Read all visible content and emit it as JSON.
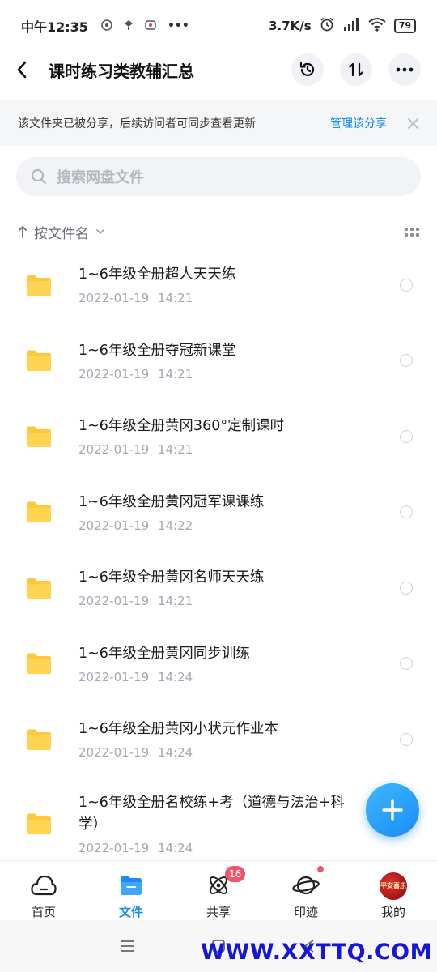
{
  "status_bar": {
    "time": "中午12:35",
    "more": "•••",
    "network_speed": "3.7K/s",
    "battery": "79"
  },
  "header": {
    "title": "课时练习类教辅汇总"
  },
  "notice": {
    "text": "该文件夹已被分享，后续访问者可同步查看更新",
    "link": "管理该分享"
  },
  "search": {
    "placeholder": "搜索网盘文件"
  },
  "sort": {
    "label": "按文件名"
  },
  "files": [
    {
      "name": "1~6年级全册超人天天练",
      "date": "2022-01-19 14:21"
    },
    {
      "name": "1~6年级全册夺冠新课堂",
      "date": "2022-01-19 14:21"
    },
    {
      "name": "1~6年级全册黄冈360°定制课时",
      "date": "2022-01-19 14:21"
    },
    {
      "name": "1~6年级全册黄冈冠军课课练",
      "date": "2022-01-19 14:22"
    },
    {
      "name": "1~6年级全册黄冈名师天天练",
      "date": "2022-01-19 14:21"
    },
    {
      "name": "1~6年级全册黄冈同步训练",
      "date": "2022-01-19 14:24"
    },
    {
      "name": "1~6年级全册黄冈小状元作业本",
      "date": "2022-01-19 14:24"
    },
    {
      "name": "1~6年级全册名校练+考（道德与法治+科学）",
      "date": "2022-01-19 14:24"
    }
  ],
  "bottom_nav": {
    "home": "首页",
    "files": "文件",
    "share": "共享",
    "share_badge": "16",
    "trace": "印迹",
    "mine": "我的",
    "avatar_text": "平安喜乐"
  },
  "watermark": "WWW.XXTTQ.COM",
  "colors": {
    "accent": "#1a8cf5",
    "folder": "#ffc93a",
    "badge": "#f1556a"
  }
}
